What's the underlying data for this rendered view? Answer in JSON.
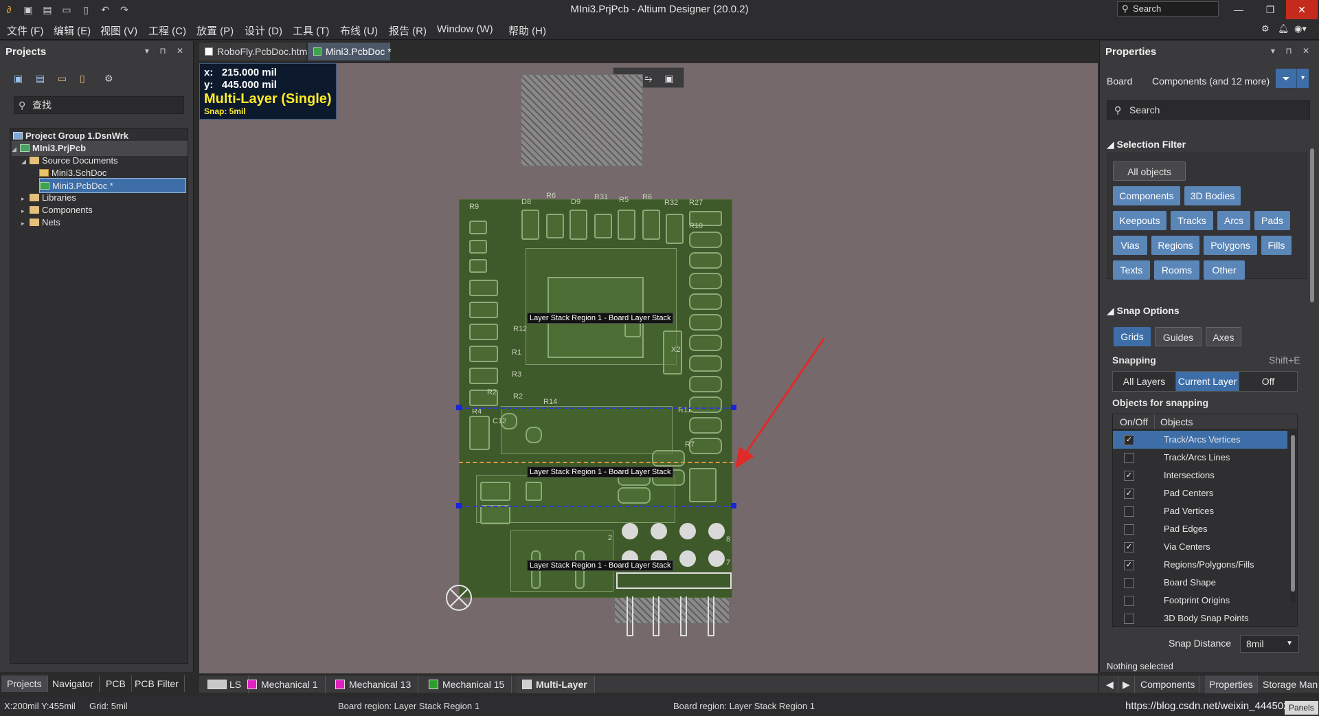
{
  "window": {
    "title": "MIni3.PrjPcb - Altium Designer (20.0.2)",
    "search_placeholder": "Search",
    "min_glyph": "—",
    "restore_glyph": "❐",
    "close_glyph": "✕"
  },
  "menu": [
    "文件 (F)",
    "编辑 (E)",
    "视图 (V)",
    "工程 (C)",
    "放置 (P)",
    "设计 (D)",
    "工具 (T)",
    "布线 (U)",
    "报告 (R)",
    "Window (W)",
    "帮助 (H)"
  ],
  "projects_panel": {
    "title": "Projects",
    "search_placeholder": "查找",
    "tree": [
      {
        "label": "Project Group 1.DsnWrk",
        "level": 0
      },
      {
        "label": "MIni3.PrjPcb",
        "level": 0
      },
      {
        "label": "Source Documents",
        "level": 1
      },
      {
        "label": "Mini3.SchDoc",
        "level": 2
      },
      {
        "label": "Mini3.PcbDoc *",
        "level": 2
      },
      {
        "label": "Libraries",
        "level": 1
      },
      {
        "label": "Components",
        "level": 1
      },
      {
        "label": "Nets",
        "level": 1
      }
    ],
    "bottom_tabs": [
      "Projects",
      "Navigator",
      "PCB",
      "PCB Filter"
    ]
  },
  "doc_tabs": [
    "RoboFly.PcbDoc.htm",
    "Mini3.PcbDoc *"
  ],
  "canvas": {
    "coord_x": "x:   215.000 mil",
    "coord_y": "y:   445.000 mil",
    "layer_name": "Multi-Layer (Single)",
    "snap": "Snap: 5mil",
    "region_label": "Layer Stack Region 1 - Board Layer Stack",
    "designators": [
      "R9",
      "D8",
      "R6",
      "D9",
      "R31",
      "R5",
      "R6",
      "R32",
      "R27",
      "R10",
      "R12",
      "R1",
      "R3",
      "R2",
      "R14",
      "R4",
      "C12",
      "R7",
      "R11",
      "X2",
      "R2",
      "2",
      "8",
      "7"
    ]
  },
  "layer_tabs": [
    {
      "label": "LS",
      "color": "#c8c8c8"
    },
    {
      "label": "Mechanical 1",
      "color": "#e020c0"
    },
    {
      "label": "Mechanical 13",
      "color": "#e020c0"
    },
    {
      "label": "Mechanical 15",
      "color": "#2aa02a"
    },
    {
      "label": "Multi-Layer",
      "color": "#d0d0d0"
    }
  ],
  "status": {
    "coords": "X:200mil Y:455mil",
    "grid": "Grid: 5mil",
    "region1": "Board region: Layer Stack Region 1",
    "region2": "Board region: Layer Stack Region 1",
    "url": "https://blog.csdn.net/weixin_44450270"
  },
  "properties": {
    "title": "Properties",
    "board_label": "Board",
    "components_label": "Components (and 12 more)",
    "search_placeholder": "Search",
    "selection_filter_title": "Selection Filter",
    "filter_buttons": [
      "All objects",
      "Components",
      "3D Bodies",
      "Keepouts",
      "Tracks",
      "Arcs",
      "Pads",
      "Vias",
      "Regions",
      "Polygons",
      "Fills",
      "Texts",
      "Rooms",
      "Other"
    ],
    "snap_options_title": "Snap Options",
    "snap_buttons": [
      "Grids",
      "Guides",
      "Axes"
    ],
    "snapping_label": "Snapping",
    "snapping_shortcut": "Shift+E",
    "snapping_modes": [
      "All Layers",
      "Current Layer",
      "Off"
    ],
    "objects_for_snapping": "Objects for snapping",
    "col_onoff": "On/Off",
    "col_objects": "Objects",
    "snap_objects": [
      {
        "name": "Track/Arcs Vertices",
        "checked": true
      },
      {
        "name": "Track/Arcs Lines",
        "checked": false
      },
      {
        "name": "Intersections",
        "checked": true
      },
      {
        "name": "Pad Centers",
        "checked": true
      },
      {
        "name": "Pad Vertices",
        "checked": false
      },
      {
        "name": "Pad Edges",
        "checked": false
      },
      {
        "name": "Via Centers",
        "checked": true
      },
      {
        "name": "Regions/Polygons/Fills",
        "checked": true
      },
      {
        "name": "Board Shape",
        "checked": false
      },
      {
        "name": "Footprint Origins",
        "checked": false
      },
      {
        "name": "3D Body Snap Points",
        "checked": false
      }
    ],
    "snap_distance_label": "Snap Distance",
    "snap_distance_value": "8mil",
    "nothing_selected": "Nothing selected",
    "bottom_tabs": [
      "Components",
      "Properties",
      "Storage Man"
    ],
    "panels_label": "Panels"
  },
  "colors": {
    "accent": "#3d6ea8",
    "board": "#3f5a2a",
    "canvas_bg": "#76696b",
    "highlight_yellow": "#ffec2a"
  }
}
